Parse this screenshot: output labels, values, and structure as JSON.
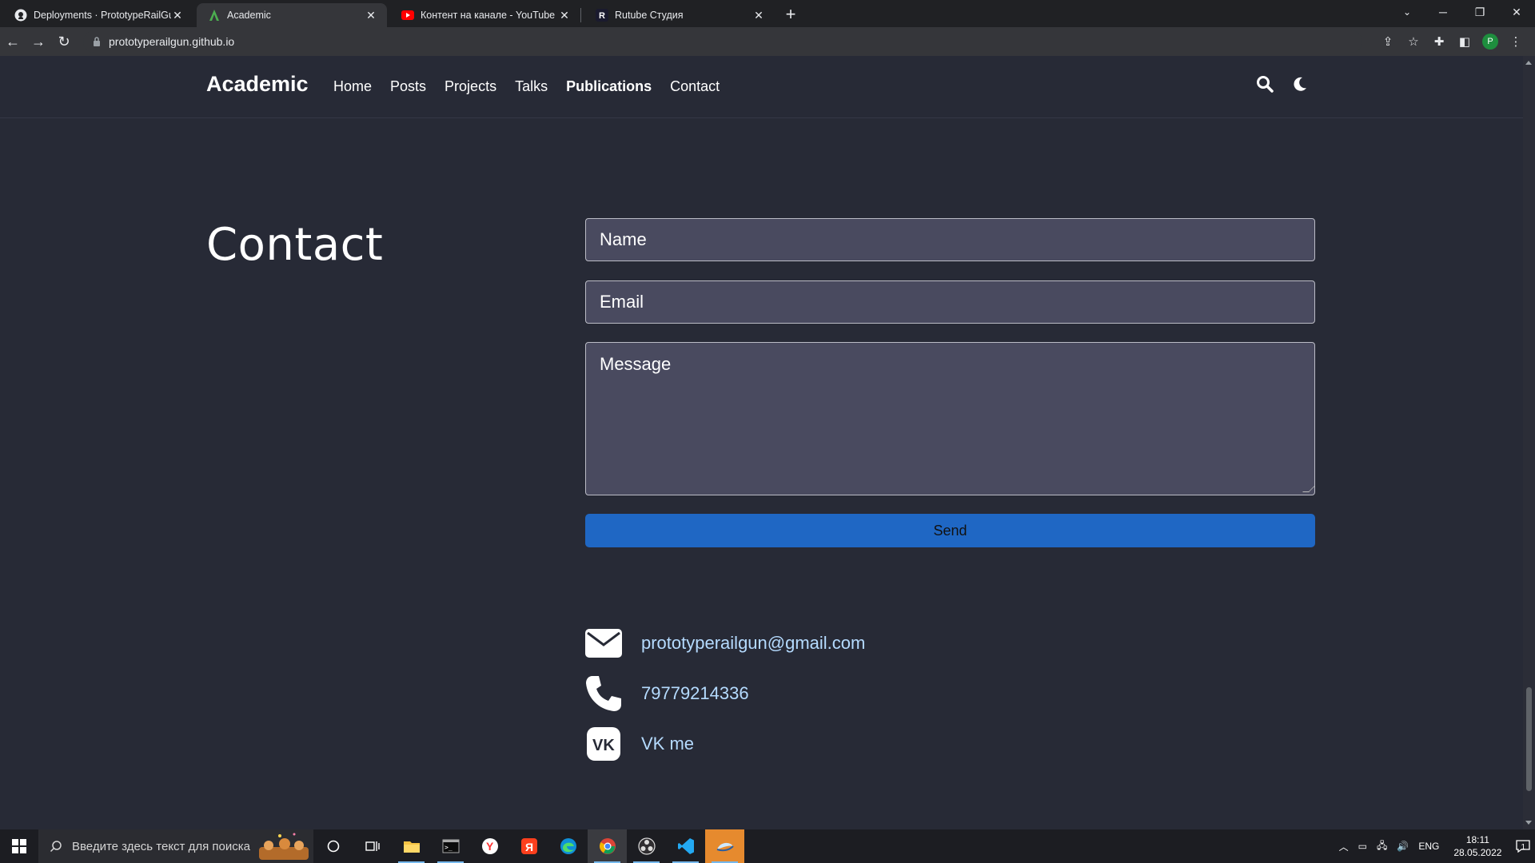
{
  "browser": {
    "tabs": [
      {
        "title": "Deployments · PrototypeRailGun",
        "favicon": "github-icon",
        "active": false
      },
      {
        "title": "Academic",
        "favicon": "academic-icon",
        "active": true
      },
      {
        "title": "Контент на канале - YouTube Stu",
        "favicon": "youtube-icon",
        "active": false
      },
      {
        "title": "Rutube Студия",
        "favicon": "rutube-icon",
        "active": false
      }
    ],
    "url": "prototyperailgun.github.io",
    "profile_initial": "P"
  },
  "site": {
    "brand": "Academic",
    "menu": [
      {
        "label": "Home",
        "bold": false
      },
      {
        "label": "Posts",
        "bold": false
      },
      {
        "label": "Projects",
        "bold": false
      },
      {
        "label": "Talks",
        "bold": false
      },
      {
        "label": "Publications",
        "bold": true
      },
      {
        "label": "Contact",
        "bold": false
      }
    ]
  },
  "contact": {
    "title": "Contact",
    "name_placeholder": "Name",
    "email_placeholder": "Email",
    "message_placeholder": "Message",
    "send_label": "Send",
    "email": "prototyperailgun@gmail.com",
    "phone": "79779214336",
    "vk": "VK me"
  },
  "taskbar": {
    "search_placeholder": "Введите здесь текст для поиска",
    "lang": "ENG",
    "time": "18:11",
    "date": "28.05.2022",
    "notifications": "1"
  },
  "colors": {
    "page_bg": "#272a36",
    "field_bg": "#494a5f",
    "button": "#1f67c4",
    "link": "#b5dbff"
  }
}
